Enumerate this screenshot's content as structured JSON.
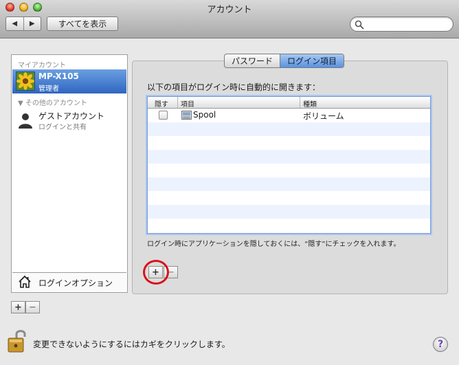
{
  "window": {
    "title": "アカウント"
  },
  "toolbar": {
    "back_glyph": "◀",
    "forward_glyph": "▶",
    "show_all_label": "すべてを表示",
    "search_placeholder": ""
  },
  "accounts": {
    "my_account_header": "マイアカウント",
    "my_account": {
      "name": "MP-X105",
      "role": "管理者"
    },
    "other_header": "▼ その他のアカウント",
    "guest": {
      "name": "ゲストアカウント",
      "sub": "ログインと共有"
    },
    "login_options_label": "ログインオプション",
    "add_label": "+",
    "remove_label": "−"
  },
  "tabs": [
    {
      "label": "パスワード",
      "active": false
    },
    {
      "label": "ログイン項目",
      "active": true
    }
  ],
  "login_items": {
    "instruction": "以下の項目がログイン時に自動的に開きます：",
    "columns": {
      "hide": "隠す",
      "item": "項目",
      "kind": "種類"
    },
    "rows": [
      {
        "checked": false,
        "name": "Spool",
        "kind": "ボリューム"
      }
    ],
    "hint": "ログイン時にアプリケーションを隠しておくには、“隠す”にチェックを入れます。",
    "add_label": "+",
    "remove_label": "−"
  },
  "footer": {
    "lock_text": "変更できないようにするにはカギをクリックします。",
    "help_label": "?"
  },
  "colors": {
    "selection": "#2f66c1",
    "highlight_circle": "#d7121b",
    "active_tab": "#5a92e0"
  }
}
